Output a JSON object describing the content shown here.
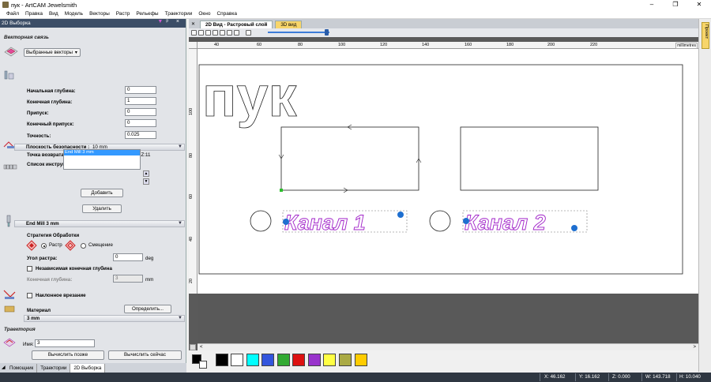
{
  "window": {
    "title": "пук - ArtCAM Jewelsmith",
    "buttons": [
      "–",
      "❐",
      "✕"
    ]
  },
  "menu": [
    "Файл",
    "Правка",
    "Вид",
    "Модель",
    "Векторы",
    "Растр",
    "Рельефы",
    "Траектории",
    "Окно",
    "Справка"
  ],
  "panel": {
    "header": "2D Выборка",
    "vector_section": "Векторная связь",
    "vector_select": "Выбранные векторы",
    "start_depth_label": "Начальная глубина:",
    "start_depth": "0",
    "end_depth_label": "Конечная глубина:",
    "end_depth": "1",
    "allowance_label": "Припуск:",
    "allowance": "0",
    "final_allowance_label": "Конечный припуск:",
    "final_allowance": "0",
    "tolerance_label": "Точность:",
    "tolerance": "0.025",
    "safe_plane_label": "Плоскость безопасности :",
    "safe_plane_value": "10 mm",
    "return_point_label": "Точка возврата:",
    "return_point_value": "X:0 Y:0 Z:11",
    "tool_list_label": "Список инструмента",
    "tool_list": [
      "End Mill 3 mm"
    ],
    "add_button": "Добавить",
    "remove_button": "Удалить",
    "tool_bar": "End Mill 3 mm",
    "strategy_label": "Стратегия Обработки",
    "strategy_raster": "Растр",
    "strategy_offset": "Смещение",
    "raster_angle_label": "Угол растра:",
    "raster_angle": "0",
    "raster_angle_unit": "deg",
    "independent_depth_label": "Независимая конечная глубина",
    "final_depth_label": "Конечная глубина:",
    "final_depth": "3",
    "final_depth_unit": "mm",
    "ramp_label": "Наклонное врезание",
    "material_label": "Материал",
    "define_button": "Определить...",
    "material_bar": "3 mm",
    "toolpath_section": "Траектория",
    "name_label": "Имя:",
    "name_value": "3",
    "calc_later_button": "Вычислить позже",
    "calc_now_button": "Вычислить сейчас"
  },
  "bottom_tabs": [
    "Помощник",
    "Траектории",
    "2D Выборка"
  ],
  "doc_tabs": [
    "2D Вид - Растровый слой",
    "3D вид"
  ],
  "ruler": {
    "h_ticks": [
      "40",
      "60",
      "80",
      "100",
      "120",
      "140",
      "160",
      "180",
      "200",
      "220"
    ],
    "v_ticks": [
      "100",
      "80",
      "60",
      "40",
      "20"
    ],
    "units": "millimetres"
  },
  "canvas": {
    "text_big": "пук",
    "text_channel1": "Канал 1",
    "text_channel2": "Канал 2"
  },
  "palette": [
    "#000000",
    "#ffffff",
    "#00ffff",
    "#3355dd",
    "#33aa33",
    "#dd1111",
    "#9933cc",
    "#ffff44",
    "#aaaa44",
    "#ffcc00"
  ],
  "status": {
    "x": "X: 46.162",
    "y": "Y: 16.162",
    "z": "Z: 0.000",
    "w": "W: 143.718",
    "h": "H: 10.040"
  },
  "right_tab": "Проект"
}
